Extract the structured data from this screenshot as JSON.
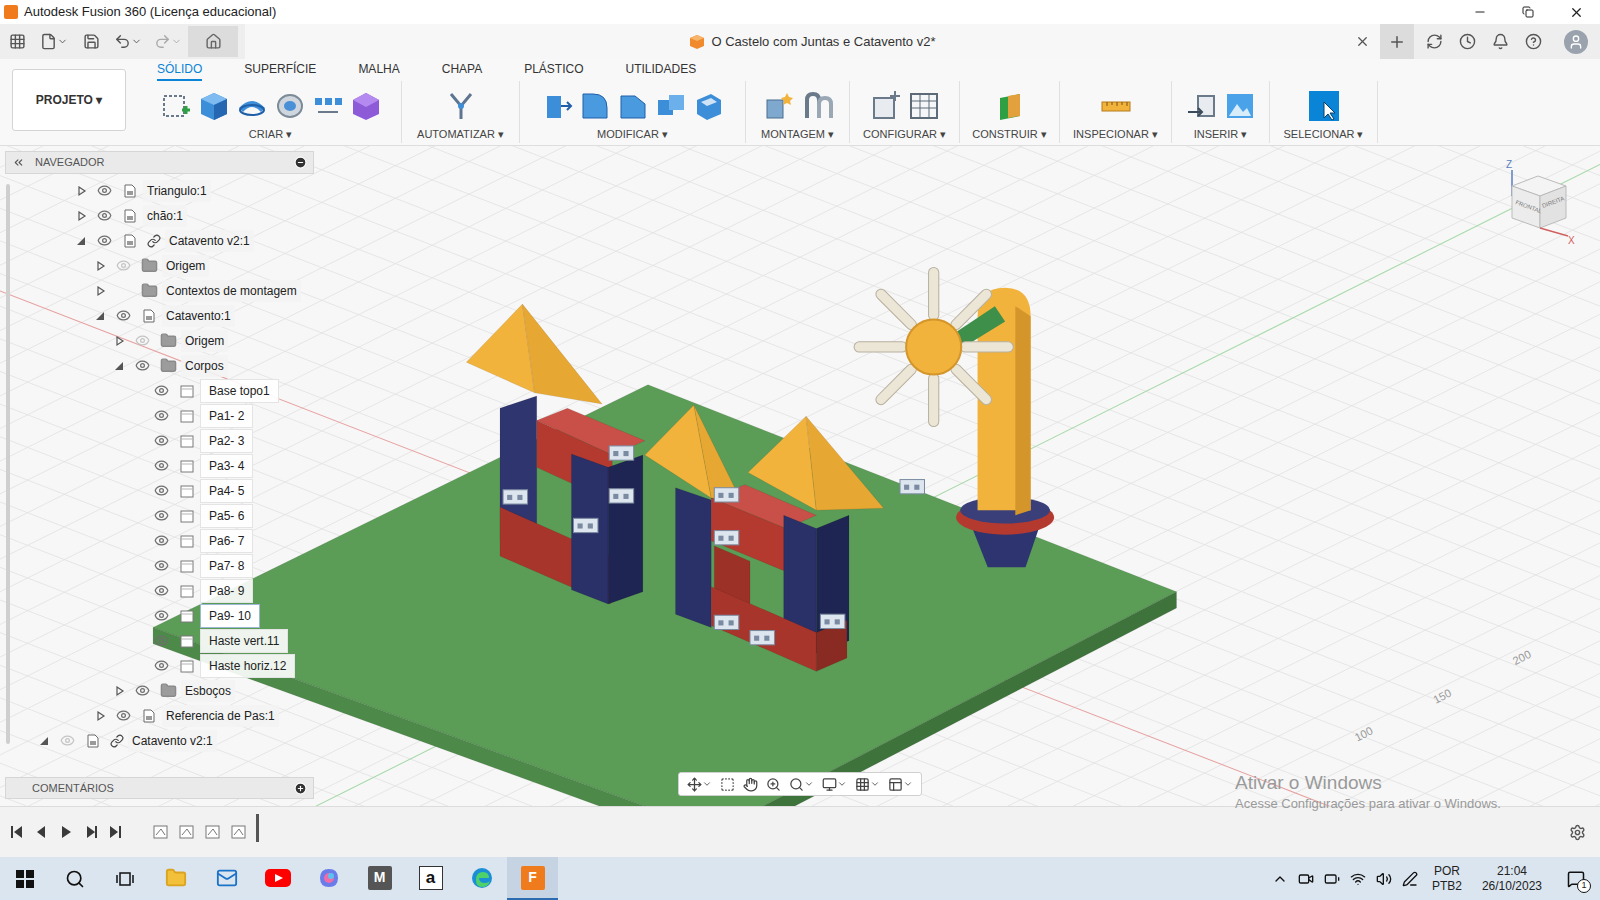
{
  "window": {
    "title": "Autodesk Fusion 360 (Licença educacional)"
  },
  "document_tab": {
    "title": "O Castelo com Juntas e Catavento v2*"
  },
  "ribbon": {
    "project_button": "PROJETO ▾",
    "tabs": [
      {
        "label": "SÓLIDO",
        "selected": true
      },
      {
        "label": "SUPERFÍCIE",
        "selected": false
      },
      {
        "label": "MALHA",
        "selected": false
      },
      {
        "label": "CHAPA",
        "selected": false
      },
      {
        "label": "PLÁSTICO",
        "selected": false
      },
      {
        "label": "UTILIDADES",
        "selected": false
      }
    ],
    "groups": [
      {
        "label": "CRIAR ▾"
      },
      {
        "label": "AUTOMATIZAR ▾"
      },
      {
        "label": "MODIFICAR ▾"
      },
      {
        "label": "MONTAGEM ▾"
      },
      {
        "label": "CONFIGURAR ▾"
      },
      {
        "label": "CONSTRUIR ▾"
      },
      {
        "label": "INSPECIONAR ▾"
      },
      {
        "label": "INSERIR ▾"
      },
      {
        "label": "SELECIONAR ▾"
      }
    ]
  },
  "navigator": {
    "title": "NAVEGADOR",
    "items": [
      {
        "label": "Triangulo:1",
        "level": 1,
        "expander": "collapsed",
        "eye": "visible",
        "kind": "component",
        "linked": false,
        "hovered": false
      },
      {
        "label": "chão:1",
        "level": 1,
        "expander": "collapsed",
        "eye": "visible",
        "kind": "component",
        "linked": false,
        "hovered": false
      },
      {
        "label": "Catavento v2:1",
        "level": 1,
        "expander": "expanded",
        "eye": "visible",
        "kind": "component",
        "linked": true,
        "hovered": false
      },
      {
        "label": "Origem",
        "level": 2,
        "expander": "collapsed",
        "eye": "hidden",
        "kind": "folder",
        "linked": false,
        "hovered": false
      },
      {
        "label": "Contextos de montagem",
        "level": 2,
        "expander": "collapsed",
        "eye": "none",
        "kind": "folder",
        "linked": false,
        "hovered": false
      },
      {
        "label": "Catavento:1",
        "level": 2,
        "expander": "expanded",
        "eye": "visible",
        "kind": "component",
        "linked": false,
        "hovered": false
      },
      {
        "label": "Origem",
        "level": 3,
        "expander": "collapsed",
        "eye": "hidden",
        "kind": "folder",
        "linked": false,
        "hovered": false
      },
      {
        "label": "Corpos",
        "level": 3,
        "expander": "expanded",
        "eye": "visible",
        "kind": "folder",
        "linked": false,
        "hovered": false
      },
      {
        "label": "Base topo1",
        "level": 4,
        "expander": "none",
        "eye": "visible",
        "kind": "body",
        "linked": false,
        "hovered": false
      },
      {
        "label": "Pa1- 2",
        "level": 4,
        "expander": "none",
        "eye": "visible",
        "kind": "body",
        "linked": false,
        "hovered": false
      },
      {
        "label": "Pa2- 3",
        "level": 4,
        "expander": "none",
        "eye": "visible",
        "kind": "body",
        "linked": false,
        "hovered": false
      },
      {
        "label": "Pa3- 4",
        "level": 4,
        "expander": "none",
        "eye": "visible",
        "kind": "body",
        "linked": false,
        "hovered": false
      },
      {
        "label": "Pa4- 5",
        "level": 4,
        "expander": "none",
        "eye": "visible",
        "kind": "body",
        "linked": false,
        "hovered": false
      },
      {
        "label": "Pa5- 6",
        "level": 4,
        "expander": "none",
        "eye": "visible",
        "kind": "body",
        "linked": false,
        "hovered": false
      },
      {
        "label": "Pa6- 7",
        "level": 4,
        "expander": "none",
        "eye": "visible",
        "kind": "body",
        "linked": false,
        "hovered": false
      },
      {
        "label": "Pa7- 8",
        "level": 4,
        "expander": "none",
        "eye": "visible",
        "kind": "body",
        "linked": false,
        "hovered": false
      },
      {
        "label": "Pa8- 9",
        "level": 4,
        "expander": "none",
        "eye": "visible",
        "kind": "body",
        "linked": false,
        "hovered": false
      },
      {
        "label": "Pa9- 10",
        "level": 4,
        "expander": "none",
        "eye": "visible",
        "kind": "body",
        "linked": false,
        "hovered": true
      },
      {
        "label": "Haste vert.11",
        "level": 4,
        "expander": "none",
        "eye": "visible",
        "kind": "body",
        "linked": false,
        "hovered": false
      },
      {
        "label": "Haste horiz.12",
        "level": 4,
        "expander": "none",
        "eye": "visible",
        "kind": "body",
        "linked": false,
        "hovered": false
      },
      {
        "label": "Esboços",
        "level": 3,
        "expander": "collapsed",
        "eye": "visible",
        "kind": "folder",
        "linked": false,
        "hovered": false
      },
      {
        "label": "Referencia de Pas:1",
        "level": 2,
        "expander": "collapsed",
        "eye": "visible",
        "kind": "component",
        "linked": false,
        "hovered": false
      },
      {
        "label": "Catavento v2:1",
        "level": 0,
        "expander": "expanded",
        "eye": "hidden",
        "kind": "component",
        "linked": true,
        "hovered": false
      }
    ]
  },
  "comments": {
    "title": "COMENTÁRIOS"
  },
  "viewcube": {
    "top_axis": "Z",
    "right_axis": "X",
    "faces": [
      "FRONTAL",
      "DIREITA"
    ]
  },
  "grid_labels": [
    "200",
    "150",
    "100"
  ],
  "watermark": {
    "title": "Ativar o Windows",
    "subtitle": "Acesse Configurações para ativar o Windows."
  },
  "taskbar": {
    "apps": [
      {
        "kind": "explorer",
        "label": "",
        "selected": false
      },
      {
        "kind": "mail",
        "label": "",
        "selected": false
      },
      {
        "kind": "youtube",
        "label": "",
        "selected": false
      },
      {
        "kind": "copilot",
        "label": "",
        "selected": false
      },
      {
        "kind": "letter",
        "label": "M",
        "selected": false
      },
      {
        "kind": "amazon",
        "label": "a",
        "selected": false
      },
      {
        "kind": "edge",
        "label": "",
        "selected": false
      },
      {
        "kind": "fusion",
        "label": "F",
        "selected": true
      }
    ],
    "language": "POR",
    "layout": "PTB2",
    "time": "21:04",
    "date": "26/10/2023",
    "notifications": "1"
  }
}
